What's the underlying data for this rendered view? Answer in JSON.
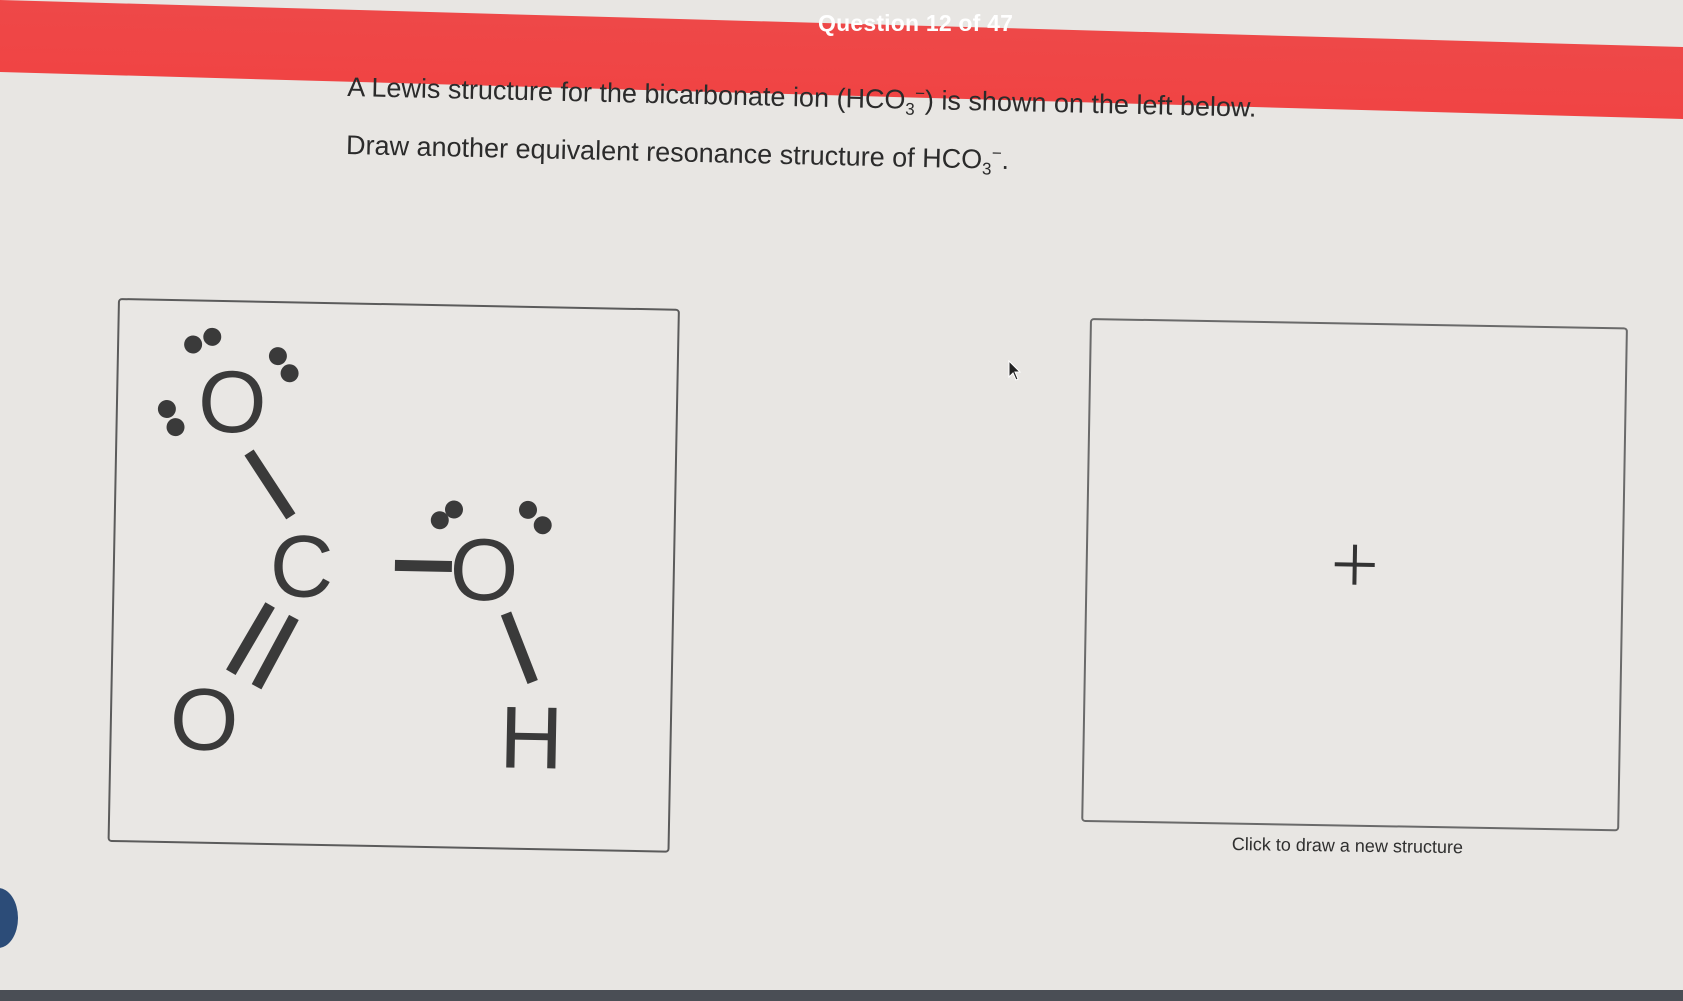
{
  "header": {
    "question_counter": "Question 12 of 47"
  },
  "prompt": {
    "line1_prefix": "A Lewis structure for the bicarbonate ion (HCO",
    "line1_sub": "3",
    "line1_sup": "−",
    "line1_suffix": ") is shown on the left below.",
    "line2_prefix": "Draw another equivalent resonance structure of HCO",
    "line2_sub": "3",
    "line2_sup": "−",
    "line2_suffix": "."
  },
  "molecule": {
    "atoms": {
      "o_top": "O",
      "carbon": "C",
      "o_right": "O",
      "o_bottom": "O",
      "hydrogen": "H"
    }
  },
  "draw_area": {
    "caption": "Click to draw a new structure",
    "add_icon": "plus-icon"
  },
  "colors": {
    "header_bar": "#f04444",
    "background": "#e8e6e3"
  }
}
